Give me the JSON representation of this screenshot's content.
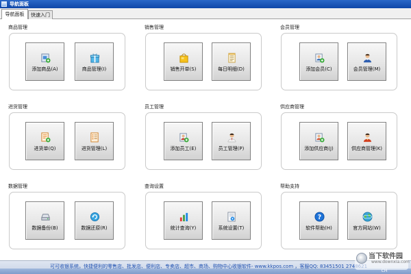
{
  "window": {
    "title": "导航面板"
  },
  "tabs": [
    {
      "label": "导航面板",
      "active": true
    },
    {
      "label": "快速入门",
      "active": false
    }
  ],
  "groups": [
    {
      "title": "商品管理",
      "buttons": [
        {
          "label": "添加商品(A)",
          "icon": "add-product-icon"
        },
        {
          "label": "商品管理(I)",
          "icon": "product-gift-icon"
        }
      ]
    },
    {
      "title": "销售管理",
      "buttons": [
        {
          "label": "销售开单(S)",
          "icon": "shopping-bag-icon"
        },
        {
          "label": "每日明细(D)",
          "icon": "daily-detail-icon"
        }
      ]
    },
    {
      "title": "会员管理",
      "buttons": [
        {
          "label": "添加会员(C)",
          "icon": "add-member-icon"
        },
        {
          "label": "会员管理(M)",
          "icon": "member-icon"
        }
      ]
    },
    {
      "title": "进货管理",
      "buttons": [
        {
          "label": "进货单(Q)",
          "icon": "purchase-order-icon"
        },
        {
          "label": "进货管理(L)",
          "icon": "purchase-list-icon"
        }
      ]
    },
    {
      "title": "员工管理",
      "buttons": [
        {
          "label": "添加员工(E)",
          "icon": "add-employee-icon"
        },
        {
          "label": "员工管理(P)",
          "icon": "employee-icon"
        }
      ]
    },
    {
      "title": "供应商管理",
      "buttons": [
        {
          "label": "添加供应商(J)",
          "icon": "add-supplier-icon"
        },
        {
          "label": "供应商管理(K)",
          "icon": "supplier-icon"
        }
      ]
    },
    {
      "title": "数据管理",
      "buttons": [
        {
          "label": "数据备份(B)",
          "icon": "backup-disk-icon"
        },
        {
          "label": "数据还原(R)",
          "icon": "restore-icon"
        }
      ]
    },
    {
      "title": "查询设置",
      "buttons": [
        {
          "label": "统计查询(Y)",
          "icon": "bar-chart-icon"
        },
        {
          "label": "系统设置(T)",
          "icon": "settings-doc-icon"
        }
      ]
    },
    {
      "title": "帮助支持",
      "buttons": [
        {
          "label": "软件帮助(H)",
          "icon": "help-icon"
        },
        {
          "label": "官方网站(W)",
          "icon": "website-globe-icon"
        }
      ]
    }
  ],
  "statusbar": {
    "text": "可可收银系统，快捷便利的零售店、批发店、便利店、专卖店、超市、商场、购物中心收银软件- www.kkpos.com ，客服QQ: 83451501  2748621"
  },
  "taskbar": {
    "lang": "CH"
  },
  "watermark": {
    "name": "当下软件园",
    "url": "www.downxia.com"
  },
  "colors": {
    "titlebar": "#1a56b8",
    "status_text": "#1d4fb0",
    "tile_border": "#7f7f7f"
  }
}
